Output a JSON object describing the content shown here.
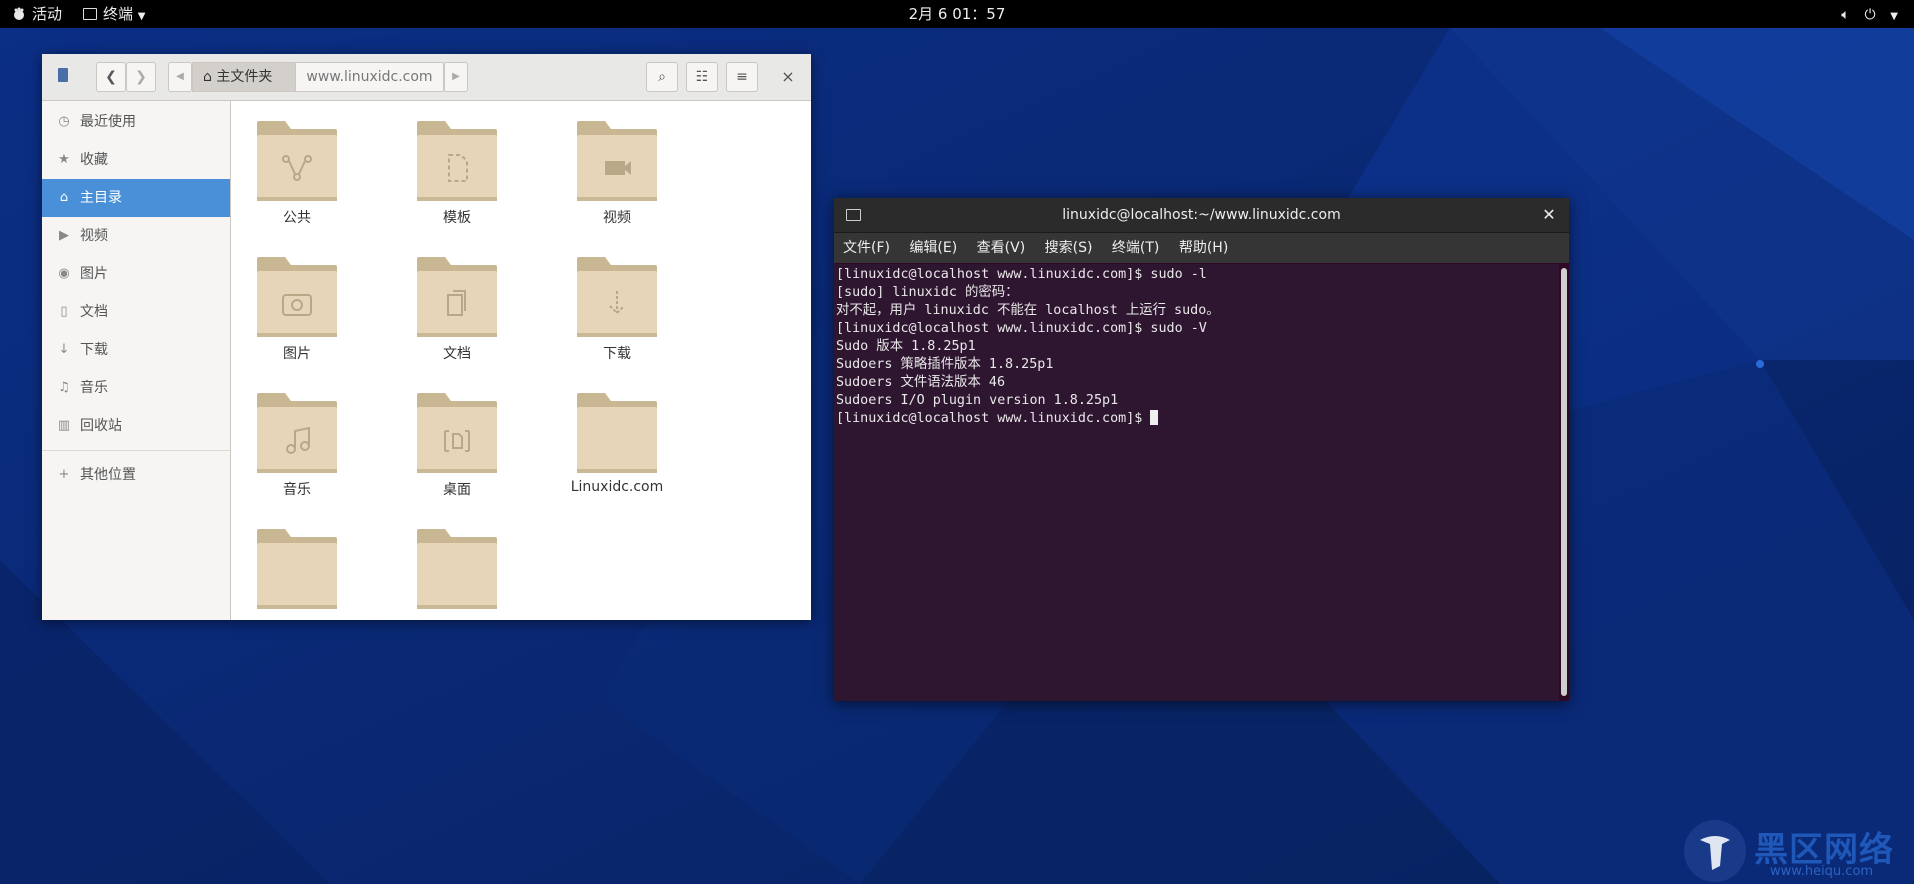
{
  "topbar": {
    "activities": "活动",
    "app_menu": "终端",
    "clock": "2月 6 01：57",
    "icons": [
      "volume-icon",
      "power-icon",
      "chevron-down-icon"
    ]
  },
  "files": {
    "breadcrumb": {
      "home": "主文件夹",
      "sub": "www.linuxidc.com"
    },
    "sidebar": [
      {
        "label": "最近使用",
        "icon": "clock-icon",
        "glyph": "◷"
      },
      {
        "label": "收藏",
        "icon": "star-icon",
        "glyph": "★"
      },
      {
        "label": "主目录",
        "icon": "home-icon",
        "glyph": "⌂"
      },
      {
        "label": "视频",
        "icon": "video-icon",
        "glyph": "▶"
      },
      {
        "label": "图片",
        "icon": "camera-icon",
        "glyph": "◉"
      },
      {
        "label": "文档",
        "icon": "document-icon",
        "glyph": "▯"
      },
      {
        "label": "下载",
        "icon": "download-icon",
        "glyph": "↓"
      },
      {
        "label": "音乐",
        "icon": "music-icon",
        "glyph": "♫"
      },
      {
        "label": "回收站",
        "icon": "trash-icon",
        "glyph": "▥"
      }
    ],
    "other_places": "其他位置",
    "folders": [
      {
        "label": "公共",
        "glyph": "share"
      },
      {
        "label": "模板",
        "glyph": "template"
      },
      {
        "label": "视频",
        "glyph": "video"
      },
      {
        "label": "图片",
        "glyph": "camera"
      },
      {
        "label": "文档",
        "glyph": "docs"
      },
      {
        "label": "下载",
        "glyph": "download"
      },
      {
        "label": "音乐",
        "glyph": "music"
      },
      {
        "label": "桌面",
        "glyph": "desktop"
      },
      {
        "label": "Linuxidc.com",
        "glyph": ""
      },
      {
        "label": "",
        "glyph": ""
      },
      {
        "label": "",
        "glyph": ""
      }
    ]
  },
  "terminal": {
    "title": "linuxidc@localhost:~/www.linuxidc.com",
    "menu": [
      "文件(F)",
      "编辑(E)",
      "查看(V)",
      "搜索(S)",
      "终端(T)",
      "帮助(H)"
    ],
    "lines": [
      "[linuxidc@localhost www.linuxidc.com]$ sudo -l",
      "[sudo] linuxidc 的密码：",
      "对不起，用户 linuxidc 不能在 localhost 上运行 sudo。",
      "[linuxidc@localhost www.linuxidc.com]$ sudo -V",
      "Sudo 版本 1.8.25p1",
      "Sudoers 策略插件版本 1.8.25p1",
      "Sudoers 文件语法版本 46",
      "Sudoers I/O plugin version 1.8.25p1",
      "[linuxidc@localhost www.linuxidc.com]$ "
    ]
  },
  "watermark": {
    "text": "黑区网络",
    "sub": "www.heiqu.com"
  },
  "colors": {
    "selection": "#4a90d9",
    "folder": "#e6d5b8",
    "wallpaper": "#0a2a78"
  }
}
